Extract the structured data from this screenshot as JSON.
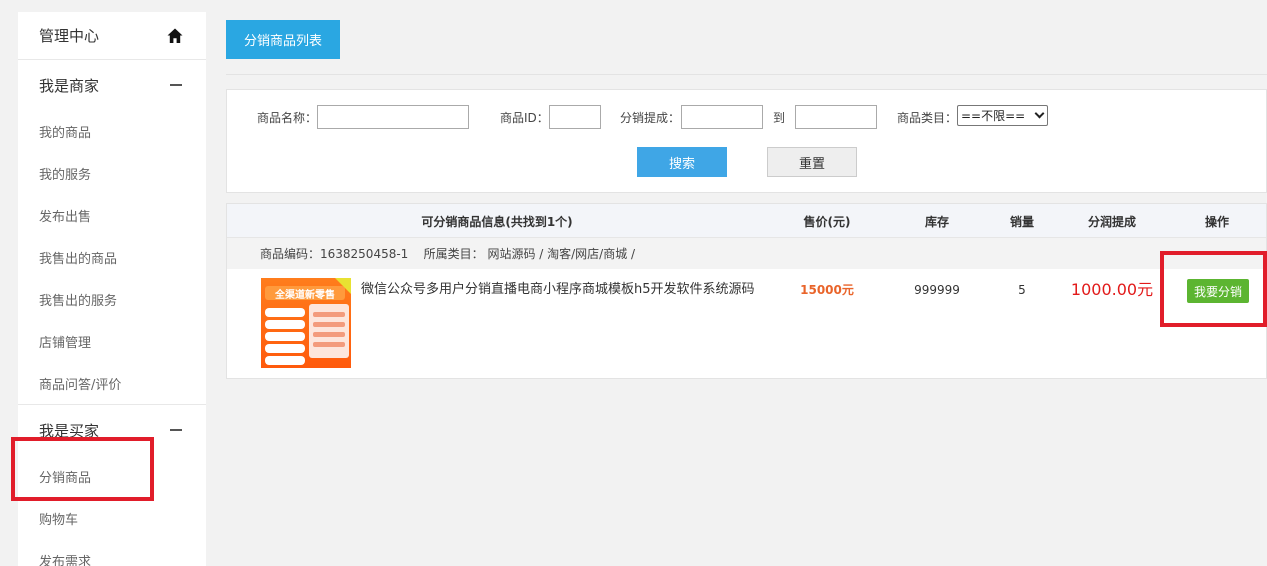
{
  "sidebar": {
    "header": "管理中心",
    "home_icon": "home-icon",
    "groups": [
      {
        "title": "我是商家",
        "items": [
          "我的商品",
          "我的服务",
          "发布出售",
          "我售出的商品",
          "我售出的服务",
          "店铺管理",
          "商品问答/评价"
        ]
      },
      {
        "title": "我是买家",
        "items": [
          "分销商品",
          "购物车",
          "发布需求"
        ]
      }
    ]
  },
  "main": {
    "tab_label": "分销商品列表",
    "search": {
      "name_label": "商品名称：",
      "name_value": "",
      "id_label": "商品ID：",
      "id_value": "",
      "commission_label": "分销提成：",
      "commission_from": "",
      "to_label": "到",
      "commission_to": "",
      "category_label": "商品类目：",
      "category_selected": "==不限==",
      "search_button": "搜索",
      "reset_button": "重置"
    },
    "table": {
      "headers": [
        "可分销商品信息(共找到1个)",
        "售价(元)",
        "库存",
        "销量",
        "分润提成",
        "操作"
      ],
      "rows": [
        {
          "code_label": "商品编码：1638250458-1",
          "category_label": "所属类目：",
          "category_path": "网站源码 / 淘客/网店/商城 /",
          "title": "微信公众号多用户分销直播电商小程序商城模板h5开发软件系统源码",
          "price": "15000元",
          "stock": "999999",
          "sold": "5",
          "commission": "1000.00元",
          "action": "我要分销",
          "thumb_text": "全渠道新零售"
        }
      ]
    }
  },
  "colors": {
    "tab": "#2aa7e2",
    "search_button": "#3fa6e6",
    "price": "#e9642a",
    "commission": "#e21a1a",
    "action": "#5cb531",
    "highlight": "#e11d2a"
  }
}
